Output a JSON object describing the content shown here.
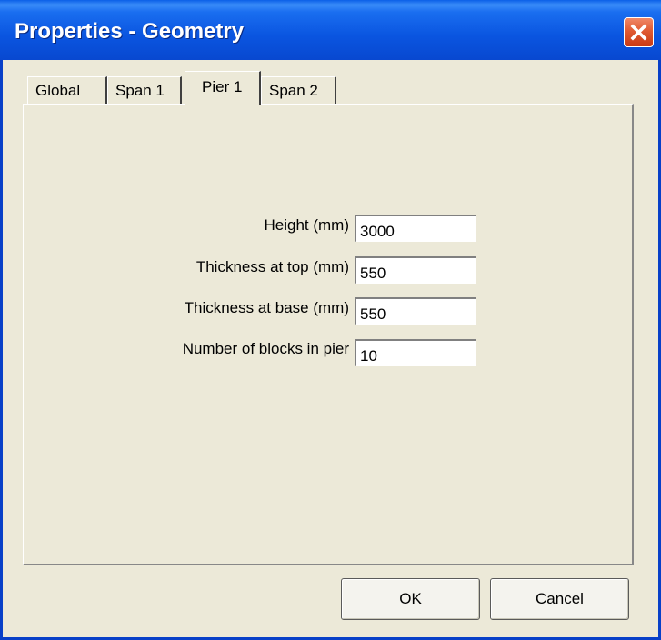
{
  "window": {
    "title": "Properties - Geometry"
  },
  "tabs": [
    {
      "label": "Global",
      "active": false
    },
    {
      "label": "Span 1",
      "active": false
    },
    {
      "label": "Pier 1",
      "active": true
    },
    {
      "label": "Span 2",
      "active": false
    }
  ],
  "fields": [
    {
      "label": "Height (mm)",
      "value": "3000"
    },
    {
      "label": "Thickness at top (mm)",
      "value": "550"
    },
    {
      "label": "Thickness at base (mm)",
      "value": "550"
    },
    {
      "label": "Number of blocks in pier",
      "value": "10"
    }
  ],
  "buttons": {
    "ok_label": "OK",
    "cancel_label": "Cancel"
  },
  "colors": {
    "titlebar": "#0a55e0",
    "close_button": "#e05a32",
    "dialog_background": "#ece9d8"
  },
  "icons": {
    "close": "close-icon"
  }
}
